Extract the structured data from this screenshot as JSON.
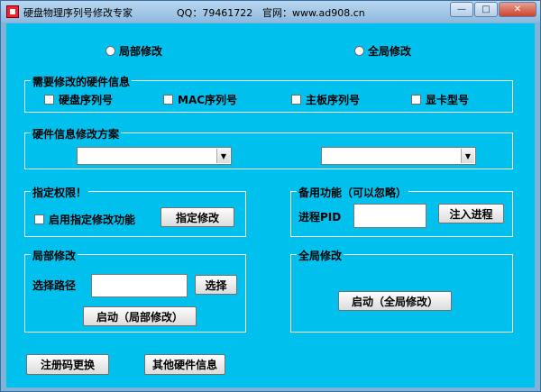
{
  "window": {
    "title": "硬盘物理序列号修改专家",
    "qq": "QQ：79461722",
    "website": "官网：www.ad908.cn"
  },
  "mode": {
    "local_label": "局部修改",
    "global_label": "全局修改"
  },
  "hardware_group": {
    "label": "需要修改的硬件信息",
    "items": [
      "硬盘序列号",
      "MAC序列号",
      "主板序列号",
      "显卡型号"
    ]
  },
  "scheme_group": {
    "label": "硬件信息修改方案",
    "combo1_value": "",
    "combo2_value": ""
  },
  "permission_group": {
    "label": "指定权限！",
    "checkbox_label": "启用指定修改功能",
    "button_label": "指定修改"
  },
  "backup_group": {
    "label": "备用功能（可以忽略）",
    "pid_label": "进程PID",
    "pid_value": "",
    "button_label": "注入进程"
  },
  "local_group": {
    "label": "局部修改",
    "path_label": "选择路径",
    "path_value": "",
    "select_label": "选择",
    "start_label": "启动（局部修改）"
  },
  "global_group": {
    "label": "全局修改",
    "start_label": "启动（全局修改）"
  },
  "bottom": {
    "register_label": "注册码更换",
    "other_label": "其他硬件信息"
  }
}
